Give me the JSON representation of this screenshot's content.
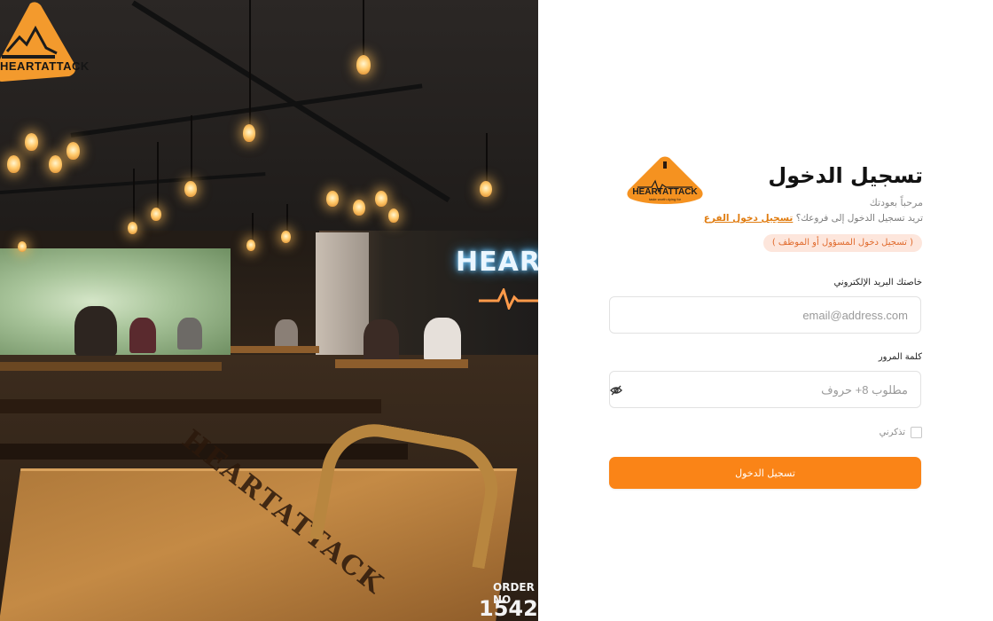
{
  "brand": {
    "photo_logo_text": "HEARTATTACK",
    "logo_name": "HEARTATTACK",
    "logo_tagline": "taste worth dying for",
    "neon_sign": "HEART",
    "table_engraving": "HEARTATTACK",
    "corner_text": "ORDER NO",
    "corner_number": "1542",
    "accent_color": "#fa8417"
  },
  "login": {
    "title": "تسجيل الدخول",
    "welcome": "مرحباً بعودتك",
    "branch_prompt": "تريد تسجيل الدخول إلى فروعك؟",
    "branch_link": "تسجيل دخول الفرع",
    "role_toggle": "( تسجيل دخول المسؤول أو الموظف )",
    "email": {
      "label": "خاصتك البريد الإلكتروني",
      "placeholder": "email@address.com",
      "value": ""
    },
    "password": {
      "label": "كلمة المرور",
      "placeholder": "مطلوب 8+ حروف",
      "value": "",
      "toggle_icon": "eye-off-icon"
    },
    "remember_me": {
      "label": "تذكرني",
      "checked": false
    },
    "submit_label": "تسجيل الدخول"
  }
}
